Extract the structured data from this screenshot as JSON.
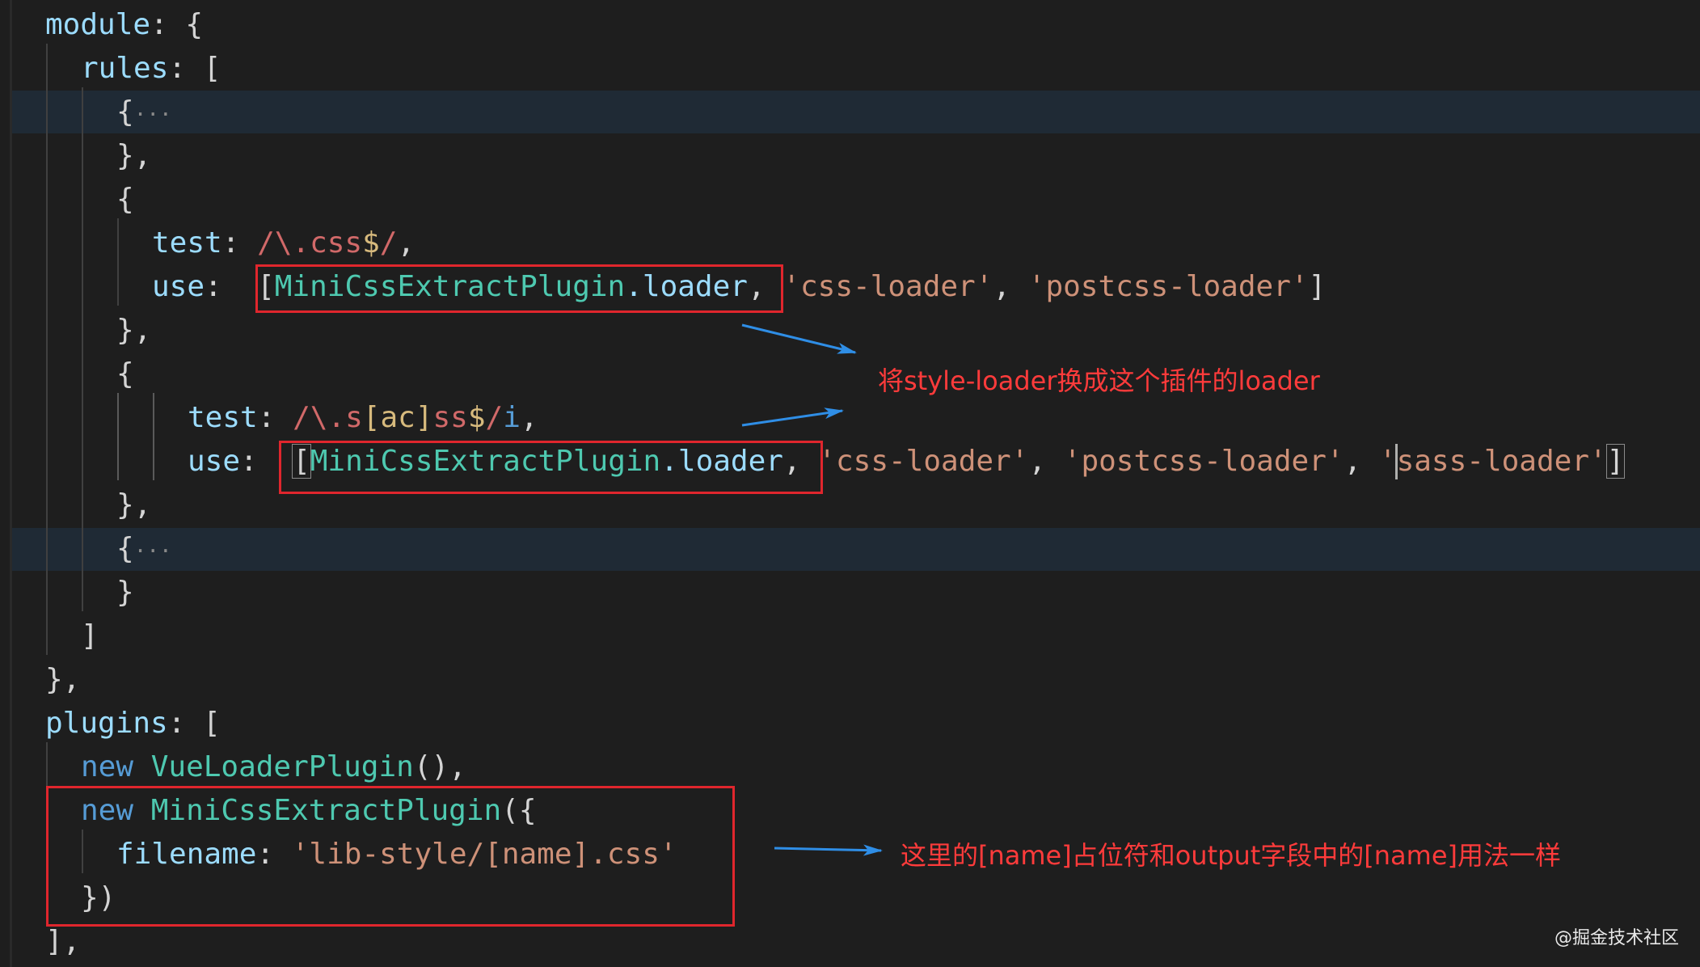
{
  "code": {
    "l1_key": "module",
    "l1_rest": ": {",
    "l2_key": "rules",
    "l2_rest": ": [",
    "l3_brace": "{",
    "fold": "···",
    "l4": "},",
    "l5": "{",
    "test_key": "test",
    "colon": ": ",
    "css_re_a": "/\\.css",
    "css_re_b": "$",
    "css_re_c": "/",
    "comma": ",",
    "use_key": "use",
    "use_colon": ":  ",
    "bracket_open": "[",
    "bracket_close": "]",
    "plugin_cls": "MiniCssExtractPlugin",
    "loader_prop": ".loader",
    "sep": ", ",
    "css_loader": "'css-loader'",
    "postcss_loader": "'postcss-loader'",
    "sass_loader": "'sass-loader'",
    "scss_re_a": "/\\.s",
    "scss_re_b": "[ac]",
    "scss_re_c": "ss",
    "scss_re_d": "$",
    "scss_re_e": "/",
    "scss_re_f": "i",
    "l13": "}",
    "l14": "]",
    "l15": "},",
    "plugins_key": "plugins",
    "plugins_rest": ": [",
    "kw_new": "new",
    "vue_plugin": "VueLoaderPlugin",
    "vue_rest": "(),",
    "mini_rest": "({",
    "filename_key": "filename",
    "filename_val": "'lib-style/[name].css'",
    "l20": "})",
    "l21": "],"
  },
  "annotations": {
    "note1": "将style-loader换成这个插件的loader",
    "note2": "这里的[name]占位符和output字段中的[name]用法一样"
  },
  "watermark": "@掘金技术社区",
  "colors": {
    "background": "#1e1e1e",
    "annotation": "#ff3b3b",
    "box": "#e0262d",
    "arrow": "#2f8ee6"
  }
}
